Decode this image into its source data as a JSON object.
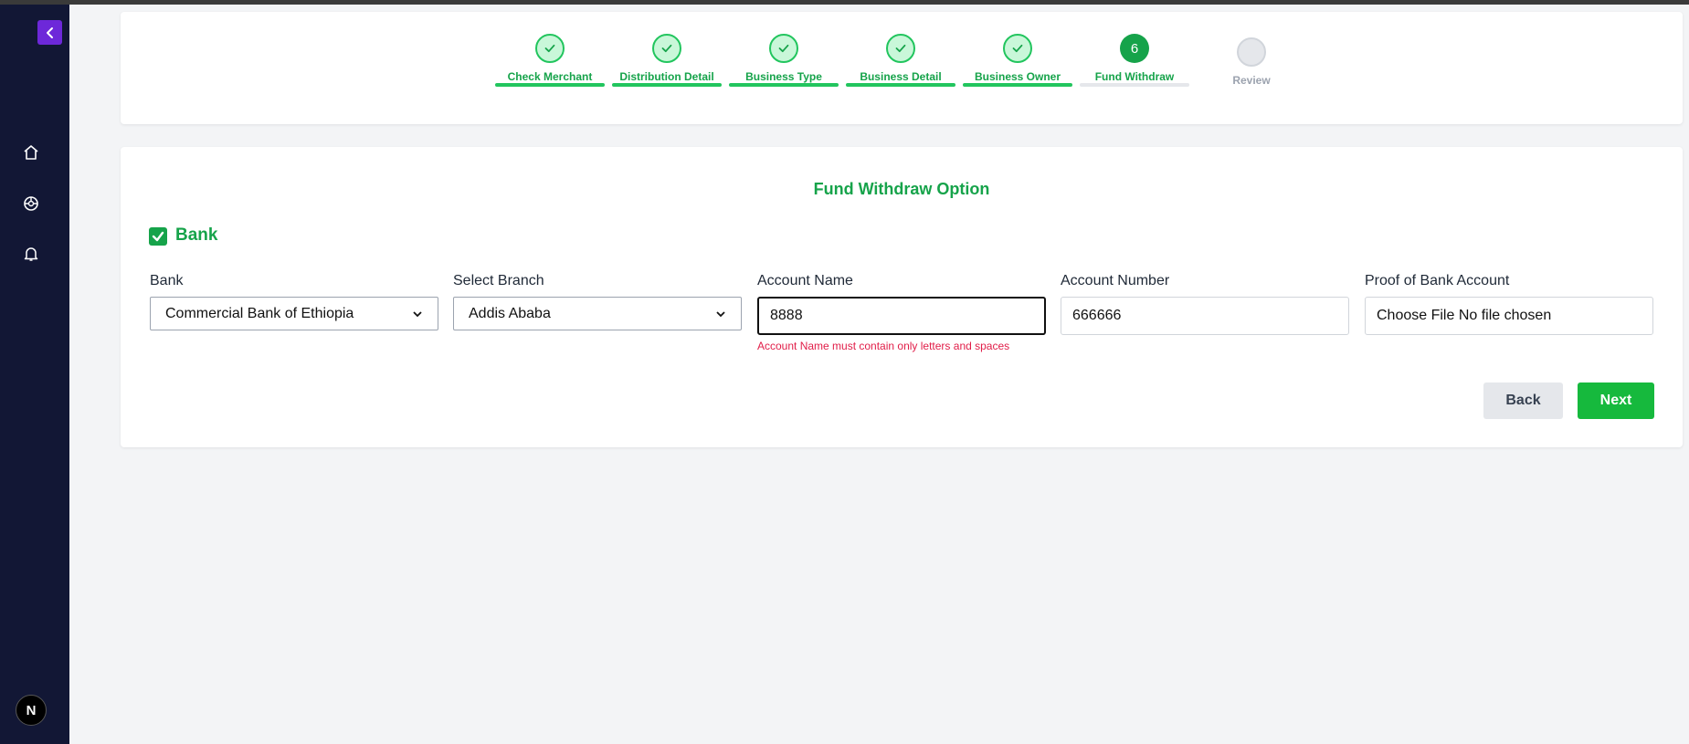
{
  "colors": {
    "accent_green": "#16a34a",
    "sidebar_bg": "#121735",
    "collapse_btn": "#6d28d9",
    "error": "#e11d48"
  },
  "sidebar": {
    "avatar_text": "N",
    "icons": [
      "chevron-left-icon",
      "home-icon",
      "globe-icon",
      "bell-icon"
    ]
  },
  "stepper": {
    "steps": [
      {
        "label": "Check Merchant",
        "state": "done"
      },
      {
        "label": "Distribution Detail",
        "state": "done"
      },
      {
        "label": "Business Type",
        "state": "done"
      },
      {
        "label": "Business Detail",
        "state": "done"
      },
      {
        "label": "Business Owner",
        "state": "done"
      },
      {
        "label": "Fund Withdraw",
        "state": "active",
        "number": "6"
      },
      {
        "label": "Review",
        "state": "pending"
      }
    ]
  },
  "form": {
    "title": "Fund Withdraw Option",
    "bank_checkbox_label": "Bank",
    "bank_checked": true,
    "bank_label": "Bank",
    "bank_value": "Commercial Bank of Ethiopia",
    "branch_label": "Select Branch",
    "branch_value": "Addis Ababa",
    "account_name_label": "Account Name",
    "account_name_value": "8888",
    "account_name_error": "Account Name must contain only letters and spaces",
    "account_number_label": "Account Number",
    "account_number_value": "666666",
    "proof_label": "Proof of Bank Account",
    "proof_value": "Choose File No file chosen",
    "back_label": "Back",
    "next_label": "Next"
  }
}
